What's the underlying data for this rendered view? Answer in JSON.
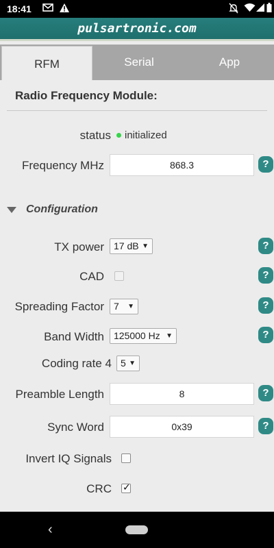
{
  "status_bar": {
    "time": "18:41",
    "icons": [
      "mail-icon",
      "alert-icon",
      "bell-off-icon",
      "wifi-icon",
      "signal-icon",
      "battery-icon"
    ]
  },
  "app": {
    "title": "pulsartronic.com"
  },
  "tabs": [
    {
      "label": "RFM",
      "active": true
    },
    {
      "label": "Serial",
      "active": false
    },
    {
      "label": "App",
      "active": false
    }
  ],
  "rfm": {
    "heading": "Radio Frequency Module:",
    "status_label": "status",
    "status_value": "initialized",
    "frequency_label": "Frequency MHz",
    "frequency_value": "868.3",
    "config_title": "Configuration",
    "tx_power_label": "TX power",
    "tx_power_value": "17 dB",
    "cad_label": "CAD",
    "cad_checked": false,
    "spreading_label": "Spreading Factor",
    "spreading_value": "7",
    "bandwidth_label": "Band Width",
    "bandwidth_value": "125000 Hz",
    "coding_label": "Coding rate 4",
    "coding_value": "5",
    "preamble_label": "Preamble Length",
    "preamble_value": "8",
    "sync_label": "Sync Word",
    "sync_value": "0x39",
    "invert_label": "Invert IQ Signals",
    "invert_checked": false,
    "crc_label": "CRC",
    "crc_checked": true,
    "help_glyph": "?"
  },
  "colors": {
    "accent": "#2f8a86",
    "titlebar": "#267e7c",
    "status_ok": "#35d44a"
  }
}
